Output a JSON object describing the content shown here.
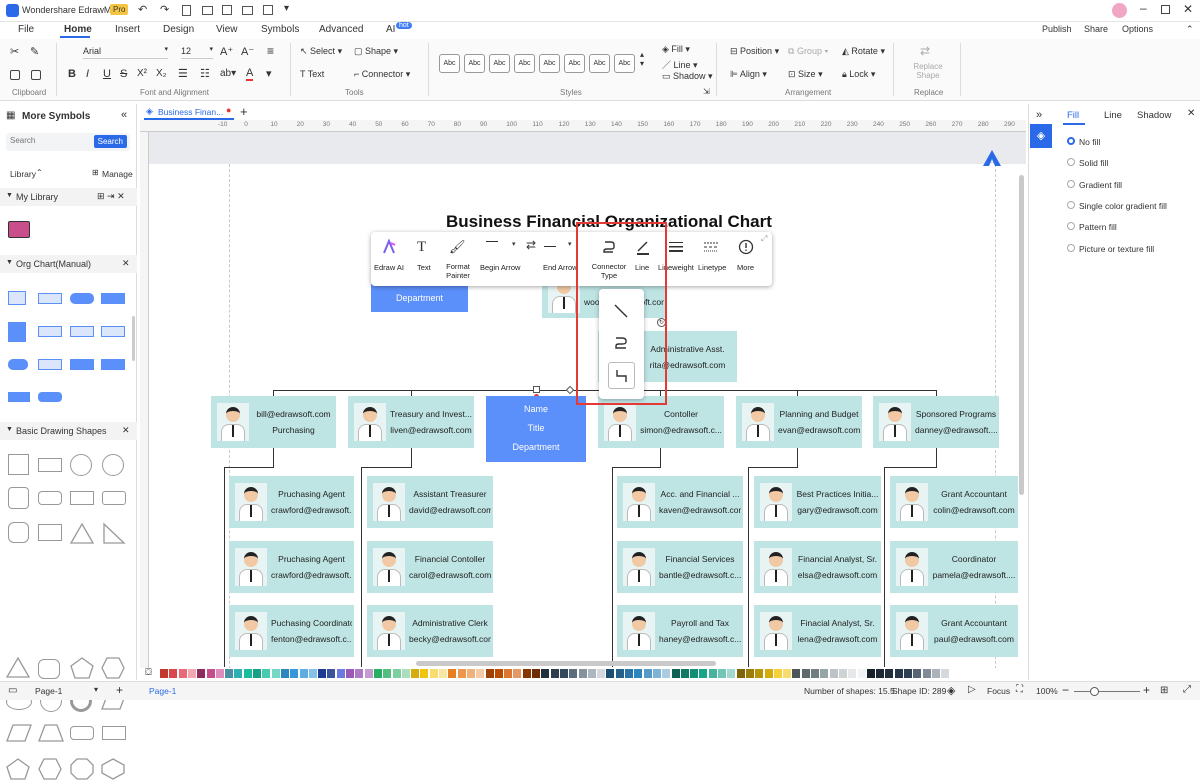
{
  "app": {
    "title": "Wondershare EdrawMax",
    "badge": "Pro"
  },
  "menu": {
    "file": "File",
    "home": "Home",
    "insert": "Insert",
    "design": "Design",
    "view": "View",
    "symbols": "Symbols",
    "advanced": "Advanced",
    "ai": "AI",
    "ai_badge": "hot",
    "publish": "Publish",
    "share": "Share",
    "options": "Options"
  },
  "ribbon": {
    "font_name": "Arial",
    "font_size": "12",
    "select": "Select",
    "shape": "Shape",
    "text": "Text",
    "connector": "Connector",
    "style_sample": "Abc",
    "fill": "Fill",
    "line": "Line",
    "shadow": "Shadow",
    "position": "Position",
    "group": "Group",
    "rotate": "Rotate",
    "align": "Align",
    "size": "Size",
    "lock": "Lock",
    "replace_shape": "Replace Shape",
    "groups": {
      "clipboard": "Clipboard",
      "font": "Font and Alignment",
      "tools": "Tools",
      "styles": "Styles",
      "arrangement": "Arrangement",
      "replace": "Replace"
    }
  },
  "left": {
    "title": "More Symbols",
    "search_placeholder": "Search",
    "search_btn": "Search",
    "library": "Library",
    "manage": "Manage",
    "my_library": "My Library",
    "org_chart": "Org Chart(Manual)",
    "basic": "Basic Drawing Shapes"
  },
  "doc_tab": "Business Finan...",
  "ruler": [
    "-10",
    "0",
    "10",
    "20",
    "30",
    "40",
    "50",
    "60",
    "70",
    "80",
    "90",
    "100",
    "110",
    "120",
    "130",
    "140",
    "150",
    "160",
    "170",
    "180",
    "190",
    "200",
    "210",
    "220",
    "230",
    "240",
    "250",
    "260",
    "270",
    "280",
    "290",
    "300",
    "310"
  ],
  "chart": {
    "title": "Business Financial Organizational Chart",
    "dept_box": "Department",
    "top_card": {
      "t1": "",
      "t2": "wood@edrawsoft.com"
    },
    "admin": {
      "t1": "Administrative Asst.",
      "t2": "rita@edrawsoft.com"
    },
    "selected": {
      "name": "Name",
      "title": "Title",
      "dept": "Department"
    },
    "row1": [
      {
        "t1": "bill@edrawsoft.com",
        "t2": "Purchasing"
      },
      {
        "t1": "Treasury and Invest...",
        "t2": "liven@edrawsoft.com"
      },
      {
        "t1": "Contoller",
        "t2": "simon@edrawsoft.c..."
      },
      {
        "t1": "Planning and Budget",
        "t2": "evan@edrawsoft.com"
      },
      {
        "t1": "Sponsored Programs",
        "t2": "danney@edrawsoft...."
      }
    ],
    "col_a": [
      {
        "t1": "Pruchasing Agent",
        "t2": "crawford@edrawsoft..."
      },
      {
        "t1": "Pruchasing Agent",
        "t2": "crawford@edrawsoft..."
      },
      {
        "t1": "Puchasing Coordinator",
        "t2": "fenton@edrawsoft.c..."
      }
    ],
    "col_b": [
      {
        "t1": "Assistant Treasurer",
        "t2": "david@edrawsoft.com"
      },
      {
        "t1": "Financial Contoller",
        "t2": "carol@edrawsoft.com"
      },
      {
        "t1": "Administrative Clerk",
        "t2": "becky@edrawsoft.com"
      }
    ],
    "col_c": [
      {
        "t1": "Acc. and Financial ...",
        "t2": "kaven@edrawsoft.com"
      },
      {
        "t1": "Financial Services",
        "t2": "bantle@edrawsoft.c..."
      },
      {
        "t1": "Payroll and Tax",
        "t2": "haney@edrawsoft.c..."
      }
    ],
    "col_d": [
      {
        "t1": "Best Practices Initia...",
        "t2": "gary@edrawsoft.com"
      },
      {
        "t1": "Financial Analyst, Sr.",
        "t2": "elsa@edrawsoft.com"
      },
      {
        "t1": "Finacial Analyst, Sr.",
        "t2": "lena@edrawsoft.com"
      }
    ],
    "col_e": [
      {
        "t1": "Grant Accountant",
        "t2": "colin@edrawsoft.com"
      },
      {
        "t1": "Coordinator",
        "t2": "pamela@edrawsoft...."
      },
      {
        "t1": "Grant Accountant",
        "t2": "paul@edrawsoft.com"
      }
    ]
  },
  "popup": {
    "ai": "Edraw AI",
    "text": "Text",
    "format": "Format Painter",
    "begin": "Begin Arrow",
    "end": "End Arrow",
    "ctype": "Connector Type",
    "line": "Line",
    "weight": "Lineweight",
    "linetype": "Linetype",
    "more": "More"
  },
  "right": {
    "tab_fill": "Fill",
    "tab_line": "Line",
    "tab_shadow": "Shadow",
    "options": [
      "No fill",
      "Solid fill",
      "Gradient fill",
      "Single color gradient fill",
      "Pattern fill",
      "Picture or texture fill"
    ]
  },
  "status": {
    "page_sel": "Page-1",
    "page_tab": "Page-1",
    "shapes": "Number of shapes: 15.5",
    "shape_id": "Shape ID: 289",
    "focus": "Focus",
    "zoom": "100%"
  },
  "colors": {
    "accent": "#5b8ff9",
    "card": "#bfe4e4",
    "highlight": "#e53935",
    "brand": "#2a6ae8"
  }
}
